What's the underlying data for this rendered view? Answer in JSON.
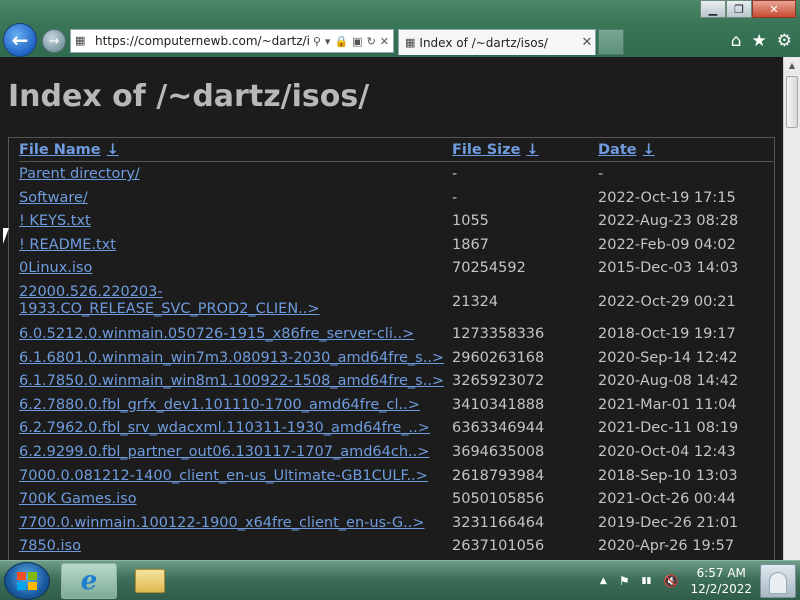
{
  "browser": {
    "address_url": "https://computernewb.com/~dartz/i",
    "tab_title": "Index of /~dartz/isos/",
    "tab_close": "✕",
    "window_controls": {
      "minimize": "▁",
      "maximize": "❐",
      "close": "✕"
    },
    "back_glyph": "←",
    "forward_glyph": "→",
    "toolbar_icons": {
      "home": "⌂",
      "favorites": "★",
      "tools": "⚙"
    },
    "address_icons": [
      "⚲",
      "▾",
      "🔒",
      "▣",
      "↻",
      "✕"
    ]
  },
  "page": {
    "title": "Index of /~dartz/isos/",
    "headers": {
      "name": "File Name",
      "size": "File Size",
      "date": "Date",
      "sort_arrow": "↓"
    },
    "rows": [
      {
        "name": "Parent directory/",
        "size": "-",
        "date": "-"
      },
      {
        "name": "Software/",
        "size": "-",
        "date": "2022-Oct-19 17:15"
      },
      {
        "name": "! KEYS.txt",
        "size": "1055",
        "date": "2022-Aug-23 08:28"
      },
      {
        "name": "! README.txt",
        "size": "1867",
        "date": "2022-Feb-09 04:02"
      },
      {
        "name": "0Linux.iso",
        "size": "70254592",
        "date": "2015-Dec-03 14:03"
      },
      {
        "name": "22000.526.220203-",
        "name2": "1933.CO_RELEASE_SVC_PROD2_CLIEN..>",
        "size": "21324",
        "date": "2022-Oct-29 00:21"
      },
      {
        "name": "6.0.5212.0.winmain.050726-1915_x86fre_server-cli..>",
        "size": "1273358336",
        "date": "2018-Oct-19 19:17"
      },
      {
        "name": "6.1.6801.0.winmain_win7m3.080913-2030_amd64fre_s..>",
        "size": "2960263168",
        "date": "2020-Sep-14 12:42"
      },
      {
        "name": "6.1.7850.0.winmain_win8m1.100922-1508_amd64fre_s..>",
        "size": "3265923072",
        "date": "2020-Aug-08 14:42"
      },
      {
        "name": "6.2.7880.0.fbl_grfx_dev1.101110-1700_amd64fre_cl..>",
        "size": "3410341888",
        "date": "2021-Mar-01 11:04"
      },
      {
        "name": "6.2.7962.0.fbl_srv_wdacxml.110311-1930_amd64fre_..>",
        "size": "6363346944",
        "date": "2021-Dec-11 08:19"
      },
      {
        "name": "6.2.9299.0.fbl_partner_out06.130117-1707_amd64ch..>",
        "size": "3694635008",
        "date": "2020-Oct-04 12:43"
      },
      {
        "name": "7000.0.081212-1400_client_en-us_Ultimate-GB1CULF..>",
        "size": "2618793984",
        "date": "2018-Sep-10 13:03"
      },
      {
        "name": "700K Games.iso",
        "size": "5050105856",
        "date": "2021-Oct-26 00:44"
      },
      {
        "name": "7700.0.winmain.100122-1900_x64fre_client_en-us-G..>",
        "size": "3231166464",
        "date": "2019-Dec-26 21:01"
      },
      {
        "name": "7850.iso",
        "size": "2637101056",
        "date": "2020-Apr-26 19:57"
      }
    ]
  },
  "taskbar": {
    "clock_time": "6:57 AM",
    "clock_date": "12/2/2022",
    "ie_glyph": "e",
    "tray_icons": [
      "▲",
      "⚑",
      "▮▮",
      "🔇"
    ]
  },
  "colors": {
    "link": "#6f9cdf",
    "text": "#c4c4c4",
    "page_bg": "#1c1c1c",
    "title": "#b8b8b8"
  }
}
